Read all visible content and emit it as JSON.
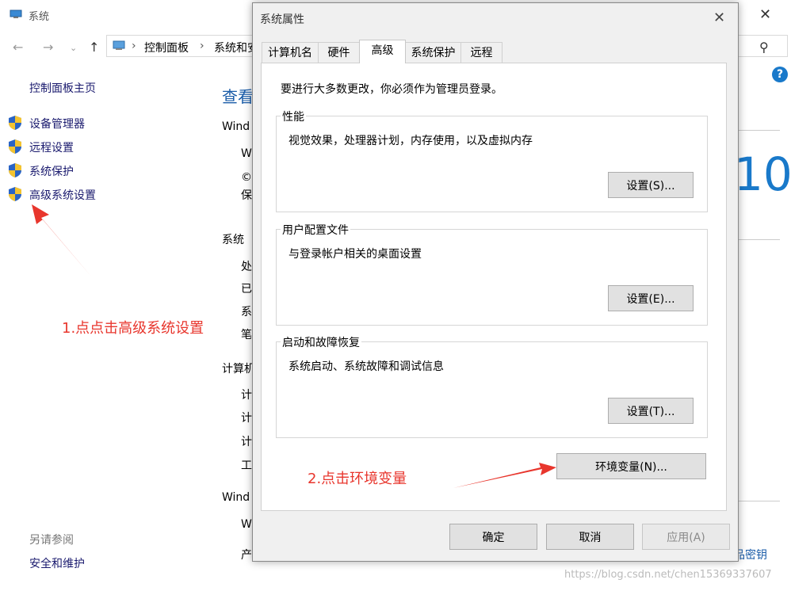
{
  "background_window": {
    "title": "系统",
    "breadcrumb": [
      "控制面板",
      "系统和安"
    ],
    "sidebar": {
      "home": "控制面板主页",
      "items": [
        "设备管理器",
        "远程设置",
        "系统保护",
        "高级系统设置"
      ],
      "see_also": "另请参阅",
      "security": "安全和维护"
    },
    "main": {
      "title_partial": "查看",
      "windows_edition_partial": "Wind",
      "edition_line1": "W",
      "edition_line2": "©",
      "edition_line3": "保",
      "system_label": "系统",
      "system_rows": [
        "处",
        "已",
        "系",
        "笔"
      ],
      "computer_label": "计算机",
      "computer_rows": [
        "计",
        "计",
        "计",
        "工"
      ],
      "activation_label": "Wind",
      "activation_row": "W",
      "product_partial": "产",
      "win10_partial": "10",
      "product_key_partial": "品密钥"
    }
  },
  "dialog": {
    "title": "系统属性",
    "tabs": [
      "计算机名",
      "硬件",
      "高级",
      "系统保护",
      "远程"
    ],
    "active_tab": "高级",
    "intro": "要进行大多数更改，你必须作为管理员登录。",
    "groups": [
      {
        "label": "性能",
        "description": "视觉效果，处理器计划，内存使用，以及虚拟内存",
        "button": "设置(S)..."
      },
      {
        "label": "用户配置文件",
        "description": "与登录帐户相关的桌面设置",
        "button": "设置(E)..."
      },
      {
        "label": "启动和故障恢复",
        "description": "系统启动、系统故障和调试信息",
        "button": "设置(T)..."
      }
    ],
    "env_button": "环境变量(N)...",
    "ok": "确定",
    "cancel": "取消",
    "apply": "应用(A)"
  },
  "annotations": {
    "step1": "1.点点击高级系统设置",
    "step2": "2.点击环境变量",
    "color": "#e8362d"
  },
  "watermark": "https://blog.csdn.net/chen15369337607",
  "accent_color": "#1979ca"
}
